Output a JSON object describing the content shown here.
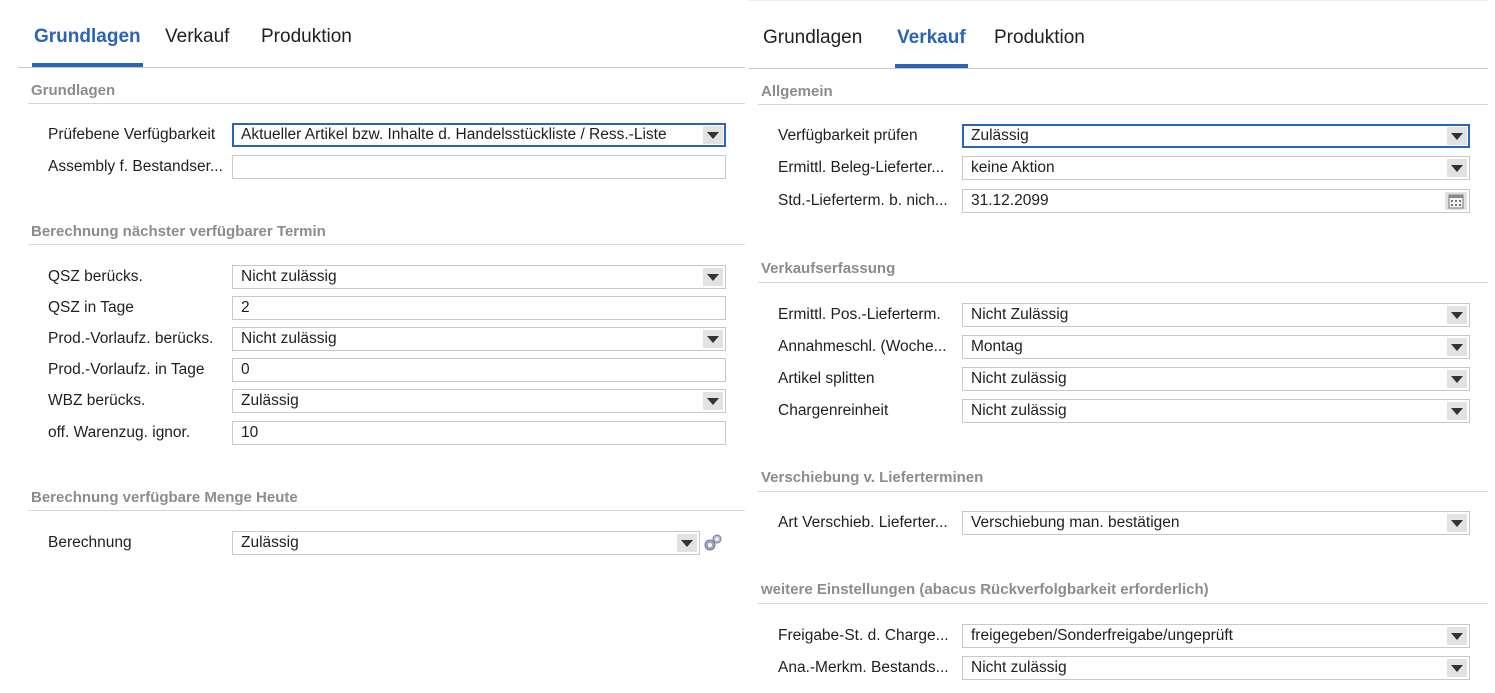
{
  "left": {
    "tabs": [
      {
        "label": "Grundlagen"
      },
      {
        "label": "Verkauf"
      },
      {
        "label": "Produktion"
      }
    ],
    "active_tab": "Grundlagen",
    "sections": [
      {
        "title": "Grundlagen",
        "fields": [
          {
            "label": "Prüfebene Verfügbarkeit",
            "value": "Aktueller Artikel bzw. Inhalte d. Handelsstückliste / Ress.-Liste"
          },
          {
            "label": "Assembly f. Bestandser...",
            "value": ""
          }
        ]
      },
      {
        "title": "Berechnung nächster verfügbarer Termin",
        "fields": [
          {
            "label": "QSZ berücks.",
            "value": "Nicht zulässig"
          },
          {
            "label": "QSZ in Tage",
            "value": "2"
          },
          {
            "label": "Prod.-Vorlaufz. berücks.",
            "value": "Nicht zulässig"
          },
          {
            "label": "Prod.-Vorlaufz. in Tage",
            "value": "0"
          },
          {
            "label": "WBZ berücks.",
            "value": "Zulässig"
          },
          {
            "label": "off. Warenzug. ignor.",
            "value": "10"
          }
        ]
      },
      {
        "title": "Berechnung verfügbare Menge Heute",
        "fields": [
          {
            "label": "Berechnung",
            "value": "Zulässig"
          }
        ]
      }
    ]
  },
  "right": {
    "tabs": [
      {
        "label": "Grundlagen"
      },
      {
        "label": "Verkauf"
      },
      {
        "label": "Produktion"
      }
    ],
    "active_tab": "Verkauf",
    "sections": [
      {
        "title": "Allgemein",
        "fields": [
          {
            "label": "Verfügbarkeit prüfen",
            "value": "Zulässig"
          },
          {
            "label": "Ermittl. Beleg-Lieferter...",
            "value": "keine Aktion"
          },
          {
            "label": "Std.-Lieferterm. b. nich...",
            "value": "31.12.2099"
          }
        ]
      },
      {
        "title": "Verkaufserfassung",
        "fields": [
          {
            "label": "Ermittl. Pos.-Lieferterm.",
            "value": "Nicht Zulässig"
          },
          {
            "label": "Annahmeschl. (Woche...",
            "value": "Montag"
          },
          {
            "label": "Artikel splitten",
            "value": "Nicht zulässig"
          },
          {
            "label": "Chargenreinheit",
            "value": "Nicht zulässig"
          }
        ]
      },
      {
        "title": "Verschiebung v. Lieferterminen",
        "fields": [
          {
            "label": "Art Verschieb. Lieferter...",
            "value": "Verschiebung man. bestätigen"
          }
        ]
      },
      {
        "title": "weitere Einstellungen (abacus Rückverfolgbarkeit erforderlich)",
        "fields": [
          {
            "label": "Freigabe-St. d. Charge...",
            "value": "freigegeben/Sonderfreigabe/ungeprüft"
          },
          {
            "label": "Ana.-Merkm. Bestands...",
            "value": "Nicht zulässig"
          }
        ]
      }
    ]
  },
  "colors": {
    "accent": "#2a63b8",
    "section_title": "#8c8c8c",
    "border": "#c8c8c8"
  },
  "icons": {
    "dropdown": "chevron-down-icon",
    "calendar": "calendar-icon",
    "settings": "gears-icon"
  }
}
